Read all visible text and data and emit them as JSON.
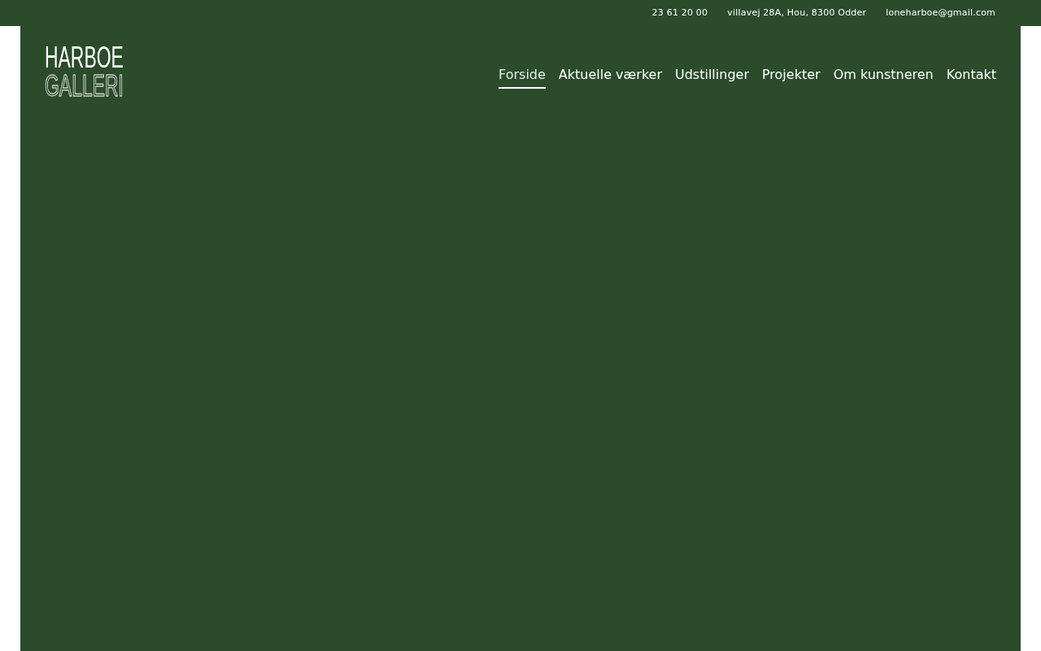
{
  "top_bar": {
    "items": [
      "23 61 20 00",
      "villavej 28A, Hou, 8300 Odder",
      "loneharboe@gmail.com"
    ]
  },
  "logo": {
    "line_1": "HARBOE",
    "line_2": "GALLERI"
  },
  "nav": [
    {
      "label": "Forside",
      "selected": true
    },
    {
      "label": "Aktuelle værker",
      "selected": false
    },
    {
      "label": "Udstillinger",
      "selected": false
    },
    {
      "label": "Projekter",
      "selected": false
    },
    {
      "label": "Om kunstneren",
      "selected": false
    },
    {
      "label": "Kontakt",
      "selected": false
    }
  ]
}
